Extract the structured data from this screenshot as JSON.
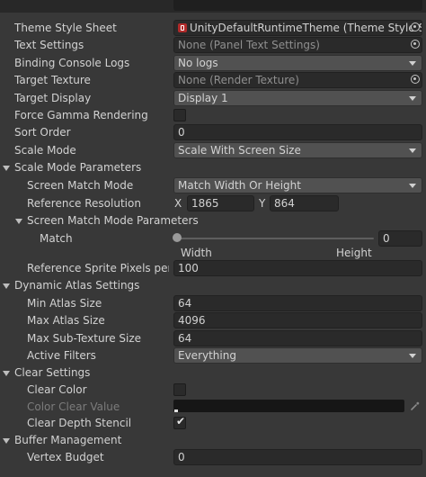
{
  "rows": {
    "theme_style_sheet": {
      "label": "Theme Style Sheet",
      "value": "UnityDefaultRuntimeTheme (Theme Style Sh"
    },
    "text_settings": {
      "label": "Text Settings",
      "value": "None (Panel Text Settings)"
    },
    "binding_console_logs": {
      "label": "Binding Console Logs",
      "value": "No logs"
    },
    "target_texture": {
      "label": "Target Texture",
      "value": "None (Render Texture)"
    },
    "target_display": {
      "label": "Target Display",
      "value": "Display 1"
    },
    "force_gamma_rendering": {
      "label": "Force Gamma Rendering",
      "checked": false
    },
    "sort_order": {
      "label": "Sort Order",
      "value": "0"
    },
    "scale_mode": {
      "label": "Scale Mode",
      "value": "Scale With Screen Size"
    },
    "scale_mode_parameters": {
      "label": "Scale Mode Parameters"
    },
    "screen_match_mode": {
      "label": "Screen Match Mode",
      "value": "Match Width Or Height"
    },
    "reference_resolution": {
      "label": "Reference Resolution",
      "x_label": "X",
      "x": "1865",
      "y_label": "Y",
      "y": "864"
    },
    "screen_match_mode_parameters": {
      "label": "Screen Match Mode Parameters"
    },
    "match": {
      "label": "Match",
      "value": "0",
      "slider_fraction": 0,
      "min_label": "Width",
      "max_label": "Height"
    },
    "reference_sprite_pixels": {
      "label": "Reference Sprite Pixels per…",
      "value": "100"
    },
    "dynamic_atlas_settings": {
      "label": "Dynamic Atlas Settings"
    },
    "min_atlas_size": {
      "label": "Min Atlas Size",
      "value": "64"
    },
    "max_atlas_size": {
      "label": "Max Atlas Size",
      "value": "4096"
    },
    "max_sub_texture_size": {
      "label": "Max Sub-Texture Size",
      "value": "64"
    },
    "active_filters": {
      "label": "Active Filters",
      "value": "Everything"
    },
    "clear_settings": {
      "label": "Clear Settings"
    },
    "clear_color": {
      "label": "Clear Color",
      "checked": false
    },
    "color_clear_value": {
      "label": "Color Clear Value",
      "color": "#000000"
    },
    "clear_depth_stencil": {
      "label": "Clear Depth Stencil",
      "checked": true,
      "check_glyph": "✔"
    },
    "buffer_management": {
      "label": "Buffer Management"
    },
    "vertex_budget": {
      "label": "Vertex Budget",
      "value": "0"
    }
  },
  "icons": {
    "theme_asset": "theme-style-sheet-icon",
    "object_picker": "object-picker-icon",
    "foldout": "foldout-arrow-icon",
    "dropdown": "chevron-down-icon",
    "eyedropper": "eyedropper-icon"
  },
  "colors": {
    "panel_bg": "#383838",
    "field_bg": "#2a2a2a",
    "dropdown_bg": "#515151",
    "text": "#d2d2d2",
    "disabled_text": "#7c7c7c",
    "asset_icon": "#b02a2a"
  }
}
